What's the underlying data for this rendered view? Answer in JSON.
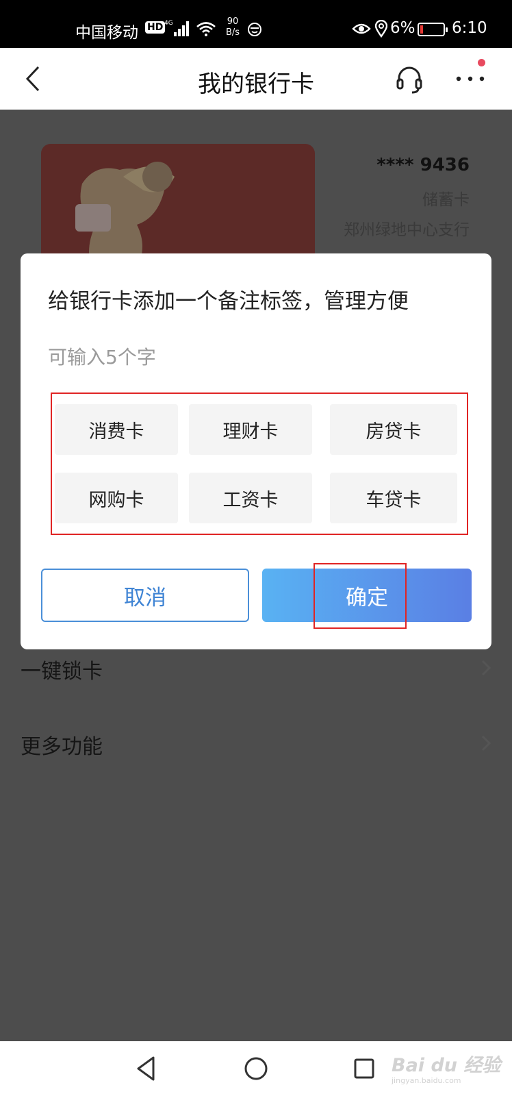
{
  "status_bar": {
    "carrier": "中国移动",
    "hd_badge": "HD",
    "network": "4G",
    "speed_value": "90",
    "speed_unit": "B/s",
    "battery_percent": "6%",
    "time": "6:10"
  },
  "nav": {
    "title": "我的银行卡"
  },
  "card": {
    "number": "**** 9436",
    "type": "储蓄卡",
    "branch": "郑州绿地中心支行"
  },
  "menu": {
    "items": [
      {
        "label": "一键锁卡"
      },
      {
        "label": "更多功能"
      }
    ]
  },
  "dialog": {
    "title": "给银行卡添加一个备注标签，管理方便",
    "hint": "可输入5个字",
    "tags": [
      "消费卡",
      "理财卡",
      "房贷卡",
      "网购卡",
      "工资卡",
      "车贷卡"
    ],
    "cancel_label": "取消",
    "ok_label": "确定"
  },
  "watermark": {
    "main": "Bai du 经验",
    "sub": "jingyan.baidu.com"
  },
  "colors": {
    "overlay": "#4d4d4d",
    "accent_blue": "#3f84d4",
    "highlight_red": "#e02424",
    "notification_dot": "#e84a5f"
  }
}
